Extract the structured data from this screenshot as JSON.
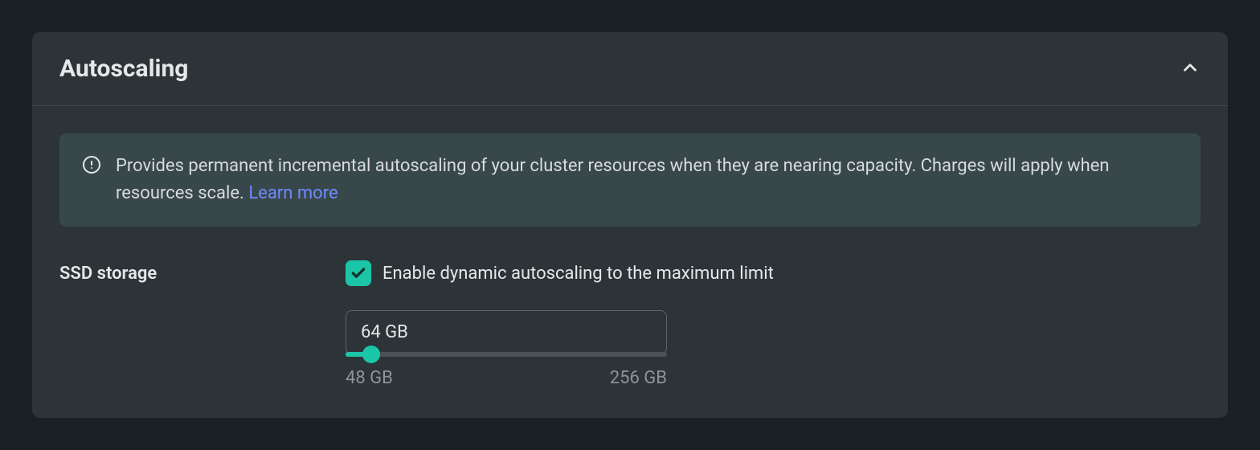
{
  "panel": {
    "title": "Autoscaling",
    "info_text": "Provides permanent incremental autoscaling of your cluster resources when they are nearing capacity. Charges will apply when resources scale. ",
    "learn_more": "Learn more"
  },
  "setting": {
    "label": "SSD storage",
    "checkbox_label": "Enable dynamic autoscaling to the maximum limit",
    "value": "64 GB",
    "min_label": "48 GB",
    "max_label": "256 GB"
  }
}
